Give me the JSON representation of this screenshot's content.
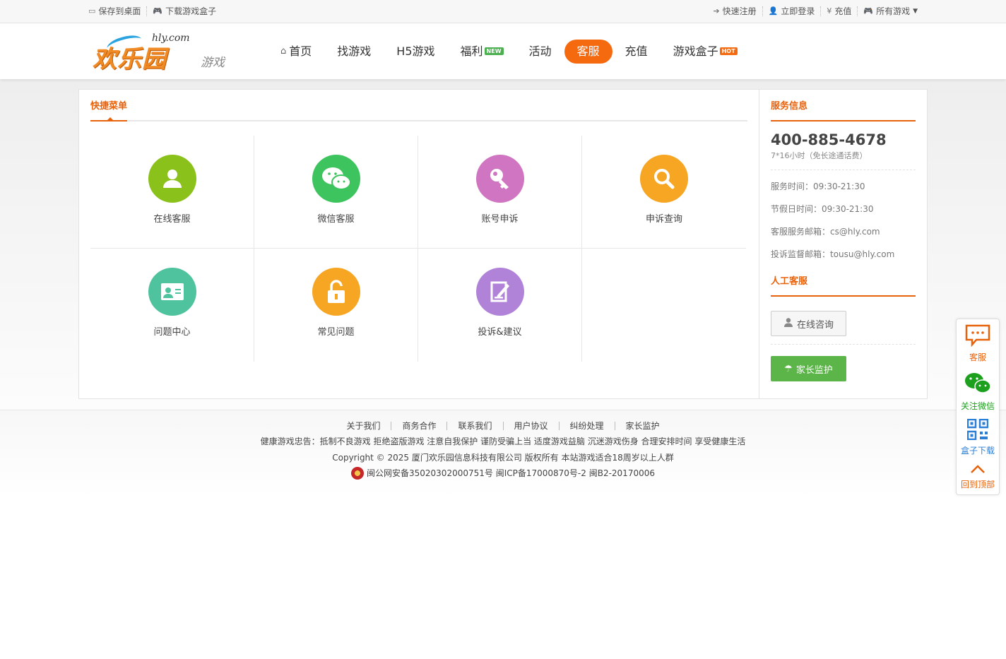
{
  "topbar": {
    "save_desktop": "保存到桌面",
    "download_box": "下载游戏盒子",
    "quick_register": "快速注册",
    "login": "立即登录",
    "recharge": "充值",
    "all_games": "所有游戏"
  },
  "logo": {
    "site": "hly.com",
    "name": "欢乐园",
    "tag": "游戏"
  },
  "nav": {
    "items": [
      {
        "label": "首页"
      },
      {
        "label": "找游戏"
      },
      {
        "label": "H5游戏"
      },
      {
        "label": "福利",
        "badge": "NEW"
      },
      {
        "label": "活动"
      },
      {
        "label": "客服"
      },
      {
        "label": "充值"
      },
      {
        "label": "游戏盒子",
        "badge": "HOT"
      }
    ],
    "active": "客服"
  },
  "quick_menu": {
    "title": "快捷菜单",
    "items": [
      {
        "label": "在线客服",
        "icon": "user-icon",
        "color": "#8bc11b"
      },
      {
        "label": "微信客服",
        "icon": "wechat-icon",
        "color": "#3dc45e"
      },
      {
        "label": "账号申诉",
        "icon": "key-icon",
        "color": "#d075c1"
      },
      {
        "label": "申诉查询",
        "icon": "search-icon",
        "color": "#f6a623"
      },
      {
        "label": "问题中心",
        "icon": "id-card-icon",
        "color": "#4ec39d"
      },
      {
        "label": "常见问题",
        "icon": "lock-icon",
        "color": "#f6a623"
      },
      {
        "label": "投诉&建议",
        "icon": "edit-icon",
        "color": "#b083d8"
      }
    ]
  },
  "service": {
    "title": "服务信息",
    "phone": "400-885-4678",
    "phone_note": "7*16小时（免长途通话费）",
    "hours": "服务时间：09:30-21:30",
    "holiday_hours": "节假日时间：09:30-21:30",
    "service_email": "客服服务邮箱：cs@hly.com",
    "complaint_email": "投诉监督邮箱：tousu@hly.com",
    "manual_title": "人工客服",
    "consult_button": "在线咨询",
    "parent_button": "家长监护"
  },
  "footer": {
    "links": [
      "关于我们",
      "商务合作",
      "联系我们",
      "用户协议",
      "纠纷处理",
      "家长监护"
    ],
    "health_notice": "健康游戏忠告：抵制不良游戏 拒绝盗版游戏 注意自我保护 谨防受骗上当 适度游戏益脑 沉迷游戏伤身 合理安排时间 享受健康生活",
    "copyright": "Copyright © 2025 厦门欢乐园信息科技有限公司 版权所有 本站游戏适合18周岁以上人群",
    "beian": "闽公网安备35020302000751号 闽ICP备17000870号-2 闽B2-20170006"
  },
  "float_bar": {
    "service": "客服",
    "wechat": "关注微信",
    "box_download": "盒子下载",
    "back_top": "回到顶部"
  }
}
